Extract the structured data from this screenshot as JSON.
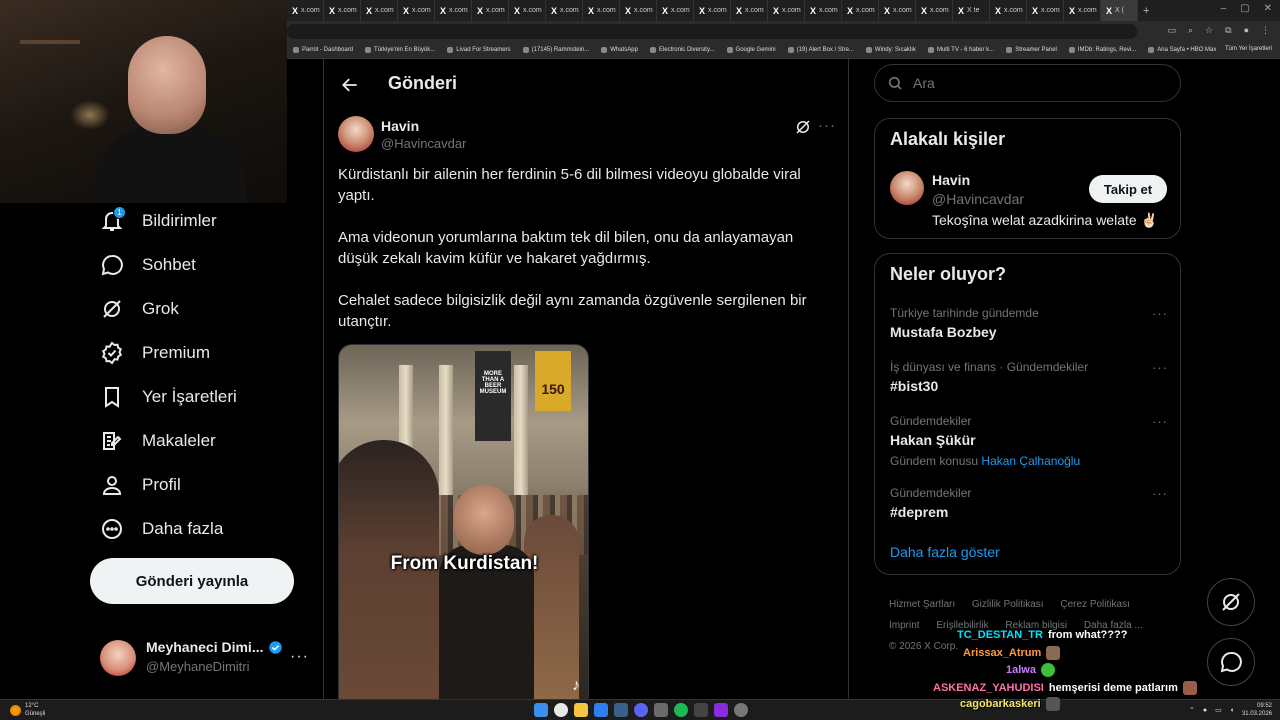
{
  "browser": {
    "tabs": [
      {
        "label": "x.com"
      },
      {
        "label": "x.com"
      },
      {
        "label": "x.com"
      },
      {
        "label": "x.com"
      },
      {
        "label": "x.com"
      },
      {
        "label": "x.com"
      },
      {
        "label": "x.com"
      },
      {
        "label": "x.com"
      },
      {
        "label": "x.com"
      },
      {
        "label": "x.com"
      },
      {
        "label": "x.com"
      },
      {
        "label": "x.com"
      },
      {
        "label": "x.com"
      },
      {
        "label": "x.com"
      },
      {
        "label": "x.com"
      },
      {
        "label": "x.com"
      },
      {
        "label": "x.com"
      },
      {
        "label": "x.com"
      },
      {
        "label": "X te"
      },
      {
        "label": "x.com"
      },
      {
        "label": "x.com"
      },
      {
        "label": "x.com"
      },
      {
        "label": "X ("
      }
    ],
    "new_tab_icon": "+",
    "bookmarks": [
      "Parrot - Dashboard",
      "Türkiye'nin En Büyük...",
      "Livad For Streamers",
      "(17145) Rammstein...",
      "WhatsApp",
      "Electronic Diversity...",
      "Google Gemini",
      "(19) Alert Box / Stre...",
      "Windy: Sıcaklık",
      "Multi TV - 6 haber k...",
      "Streamer Panel",
      "IMDb: Ratings, Revi...",
      "Ana Sayfa • HBO Max"
    ],
    "all_bookmarks": "Tüm Yer İşaretleri"
  },
  "nav": {
    "notifications_badge": "1",
    "items": [
      {
        "label": "Bildirimler"
      },
      {
        "label": "Sohbet"
      },
      {
        "label": "Grok"
      },
      {
        "label": "Premium"
      },
      {
        "label": "Yer İşaretleri"
      },
      {
        "label": "Makaleler"
      },
      {
        "label": "Profil"
      },
      {
        "label": "Daha fazla"
      }
    ],
    "post_button": "Gönderi yayınla",
    "account": {
      "name": "Meyhaneci Dimi...",
      "handle": "@MeyhaneDimitri",
      "more": "···"
    }
  },
  "main": {
    "title": "Gönderi",
    "author": {
      "name": "Havin",
      "handle": "@Havincavdar"
    },
    "more": "···",
    "paragraphs": [
      "Kürdistanlı bir ailenin her ferdinin 5-6 dil bilmesi videoyu globalde viral yaptı.",
      "Ama videonun yorumlarına baktım tek dil bilen, onu da anlayamayan düşük zekalı kavim küfür ve hakaret yağdırmış.",
      "Cehalet sadece bilgisizlik değil aynı zamanda özgüvenle sergilenen bir utançtır."
    ],
    "media": {
      "caption": "From Kurdistan!",
      "banner_text": "MORE THAN A BEER MUSEUM",
      "sign_text": "150"
    }
  },
  "sidebar": {
    "search_placeholder": "Ara",
    "related": {
      "title": "Alakalı kişiler",
      "name": "Havin",
      "handle": "@Havincavdar",
      "bio": "Tekoşîna welat azadkirina welate ✌🏻",
      "follow": "Takip et"
    },
    "trends": {
      "title": "Neler oluyor?",
      "items": [
        {
          "meta": "Türkiye tarihinde gündemde",
          "name": "Mustafa Bozbey",
          "sub": "",
          "sub_link": ""
        },
        {
          "meta": "İş dünyası ve finans · Gündemdekiler",
          "name": "#bist30",
          "sub": "",
          "sub_link": ""
        },
        {
          "meta": "Gündemdekiler",
          "name": "Hakan Şükür",
          "sub": "Gündem konusu",
          "sub_link": "Hakan Çalhanoğlu"
        },
        {
          "meta": "Gündemdekiler",
          "name": "#deprem",
          "sub": "",
          "sub_link": ""
        }
      ],
      "show_more": "Daha fazla göster"
    },
    "footer": [
      "Hizmet Şartları",
      "Gizlilik Politikası",
      "Çerez Politikası",
      "Imprint",
      "Erişilebilirlik",
      "Reklam bilgisi",
      "Daha fazla ...",
      "© 2026 X Corp."
    ]
  },
  "chat": [
    {
      "user": "TC_DESTAN_TR",
      "color": "#00e5ff",
      "msg": "from what????"
    },
    {
      "user": "Arissax_Atrum",
      "color": "#ff9a3c",
      "msg": ""
    },
    {
      "user": "1alwa",
      "color": "#c77dff",
      "msg": ""
    },
    {
      "user": "ASKENAZ_YAHUDISI",
      "color": "#ff6fa8",
      "msg": "hemşerisi deme patlarım"
    },
    {
      "user": "cagobarkaskeri",
      "color": "#f5e663",
      "msg": ""
    }
  ],
  "taskbar": {
    "weather_temp": "12°C",
    "weather_desc": "Güneşli",
    "time": "09:52",
    "date": "31.03.2026"
  },
  "colors": {
    "accent": "#1d9bf0",
    "verified": "#1d9bf0",
    "background": "#000000"
  }
}
